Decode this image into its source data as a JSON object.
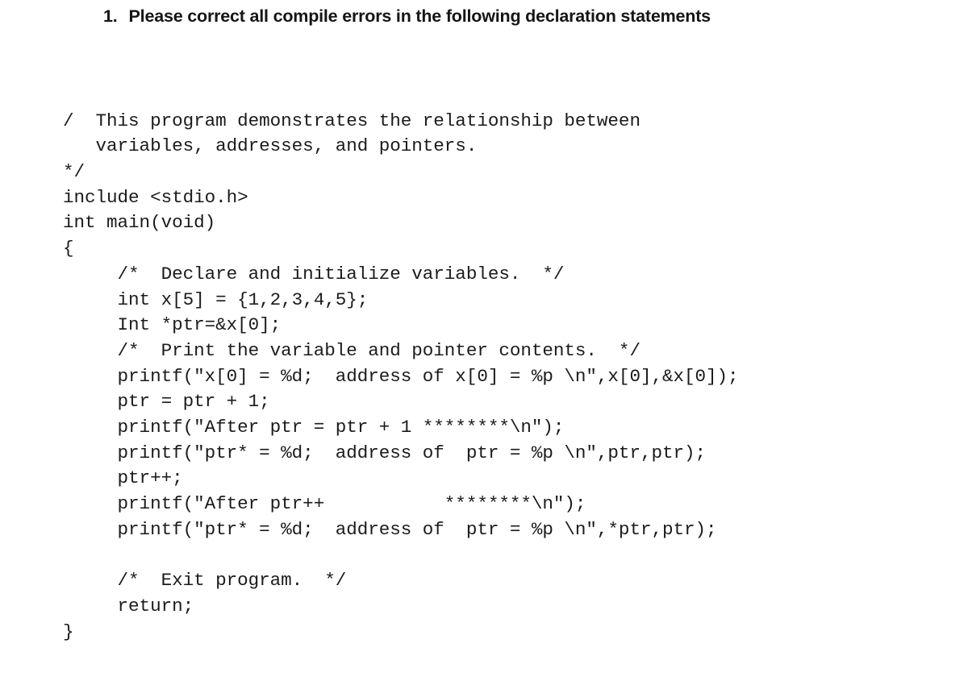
{
  "question": {
    "number": "1.",
    "text": "Please correct all compile errors in the following declaration statements"
  },
  "code": {
    "language": "c",
    "lines": [
      "/  This program demonstrates the relationship between",
      "   variables, addresses, and pointers.",
      "*/",
      "include <stdio.h>",
      "int main(void)",
      "{",
      "     /*  Declare and initialize variables.  */",
      "     int x[5] = {1,2,3,4,5};",
      "     Int *ptr=&x[0];",
      "     /*  Print the variable and pointer contents.  */",
      "     printf(\"x[0] = %d;  address of x[0] = %p \\n\",x[0],&x[0]);",
      "     ptr = ptr + 1;",
      "     printf(\"After ptr = ptr + 1 ********\\n\");",
      "     printf(\"ptr* = %d;  address of  ptr = %p \\n\",ptr,ptr);",
      "     ptr++;",
      "     printf(\"After ptr++           ********\\n\");",
      "     printf(\"ptr* = %d;  address of  ptr = %p \\n\",*ptr,ptr);",
      "",
      "     /*  Exit program.  */",
      "     return;",
      "}"
    ]
  },
  "colors": {
    "background": "#ffffff",
    "text": "#1b1b1b",
    "heading": "#151515"
  }
}
